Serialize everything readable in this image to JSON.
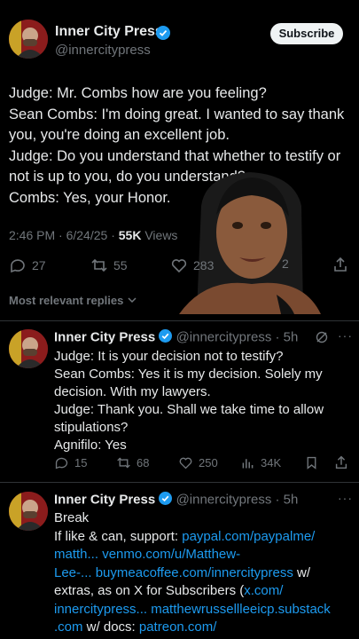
{
  "main_tweet": {
    "author_name": "Inner City Press",
    "handle": "@innercitypress",
    "subscribe_label": "Subscribe",
    "text": "Judge: Mr. Combs how are you feeling?\nSean Combs: I'm doing great. I wanted to say thank you, you're doing an excellent job.\nJudge: Do you understand that whether to testify or not is up to you, do you understand?\nCombs: Yes, your Honor.",
    "time": "2:46 PM",
    "date": "6/24/25",
    "views_count": "55K",
    "views_label": "Views",
    "replies": "27",
    "reposts": "55",
    "likes": "283",
    "bookmarks": "2",
    "sort_label": "Most relevant replies"
  },
  "replies": [
    {
      "author_name": "Inner City Press",
      "handle": "@innercitypress",
      "age": "5h",
      "text": "Judge: It is your decision not to testify?\nSean Combs: Yes it is my decision. Solely my decision. With my lawyers.\nJudge: Thank you. Shall we take time to allow stipulations?\nAgnifilo: Yes",
      "replies": "15",
      "reposts": "68",
      "likes": "250",
      "views": "34K"
    },
    {
      "author_name": "Inner City Press",
      "handle": "@innercitypress",
      "age": "5h",
      "line1": "Break",
      "line2_prefix": "If like & can, support: ",
      "link_paypal": "paypal.com/paypalme/",
      "line3_a": "matth...",
      "link_venmo": " venmo.com/u/Matthew-",
      "line4_a": "Lee-...",
      "link_bmac": " buymeacoffee.com/innercitypress",
      "line4_suffix": " w/",
      "line5_prefix": "extras, as on X for Subscribers (",
      "link_x": "x.com/",
      "line6_a": "innercitypress...",
      "link_substack": "  matthewrussellleeicp.substack",
      "line7_a": ".com",
      "line7_mid": " w/ docs: ",
      "link_patreon": "patreon.com/"
    }
  ],
  "colors": {
    "accent": "#1d9bf0",
    "muted": "#71767b",
    "text": "#e7e9ea",
    "background": "#000000"
  }
}
